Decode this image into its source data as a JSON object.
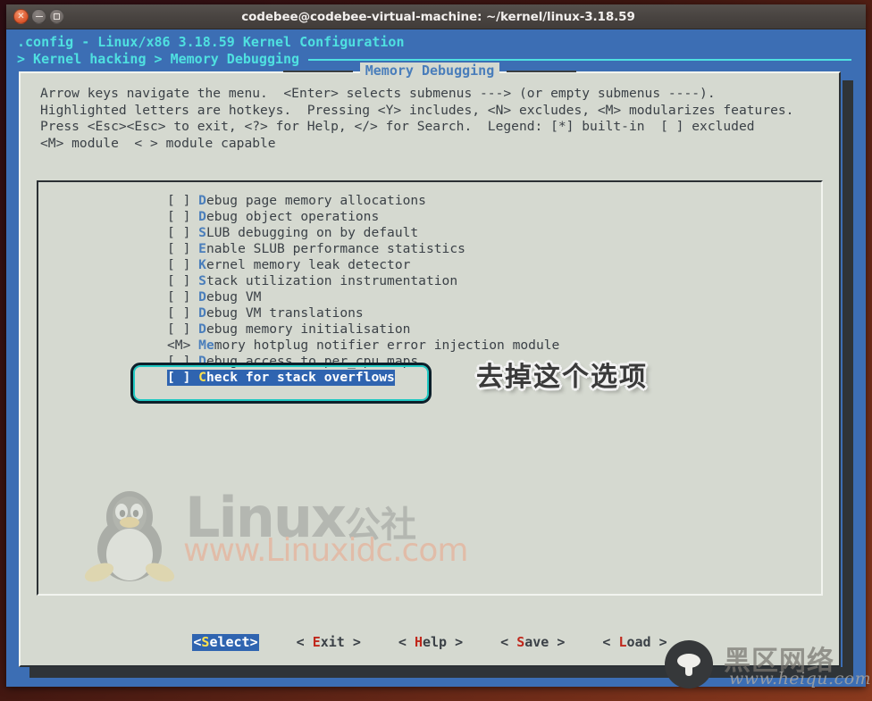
{
  "window": {
    "title": "codebee@codebee-virtual-machine: ~/kernel/linux-3.18.59",
    "controls": {
      "close": "close-icon",
      "minimize": "minimize-icon",
      "maximize": "maximize-icon"
    }
  },
  "terminal": {
    "header_line1": ".config - Linux/x86 3.18.59 Kernel Configuration",
    "header_line2": "> Kernel hacking > Memory Debugging"
  },
  "dialog": {
    "title": "Memory Debugging",
    "help_text": "Arrow keys navigate the menu.  <Enter> selects submenus ---> (or empty submenus ----).\nHighlighted letters are hotkeys.  Pressing <Y> includes, <N> excludes, <M> modularizes features.\nPress <Esc><Esc> to exit, <?> for Help, </> for Search.  Legend: [*] built-in  [ ] excluded\n<M> module  < > module capable"
  },
  "menu": {
    "items": [
      {
        "marker": "[ ]",
        "hotkey": "D",
        "rest": "ebug page memory allocations",
        "selected": false
      },
      {
        "marker": "[ ]",
        "hotkey": "D",
        "rest": "ebug object operations",
        "selected": false
      },
      {
        "marker": "[ ]",
        "hotkey": "S",
        "rest": "LUB debugging on by default",
        "selected": false
      },
      {
        "marker": "[ ]",
        "hotkey": "E",
        "rest": "nable SLUB performance statistics",
        "selected": false
      },
      {
        "marker": "[ ]",
        "hotkey": "K",
        "rest": "ernel memory leak detector",
        "selected": false
      },
      {
        "marker": "[ ]",
        "hotkey": "S",
        "rest": "tack utilization instrumentation",
        "selected": false
      },
      {
        "marker": "[ ]",
        "hotkey": "D",
        "rest": "ebug VM",
        "selected": false
      },
      {
        "marker": "[ ]",
        "hotkey": "D",
        "rest": "ebug VM translations",
        "selected": false
      },
      {
        "marker": "[ ]",
        "hotkey": "D",
        "rest": "ebug memory initialisation",
        "selected": false
      },
      {
        "marker": "<M>",
        "hotkey": "Me",
        "rest": "mory hotplug notifier error injection module",
        "selected": false
      },
      {
        "marker": "[ ]",
        "hotkey": "D",
        "rest": "ebug access to per_cpu maps",
        "selected": false
      },
      {
        "marker": "[ ]",
        "hotkey": "C",
        "rest": "heck for stack overflows",
        "selected": true
      }
    ]
  },
  "buttons": [
    {
      "pre": "<",
      "hotkey": "S",
      "post": "elect>",
      "active": true
    },
    {
      "pre": "< ",
      "hotkey": "E",
      "post": "xit >",
      "active": false
    },
    {
      "pre": "< ",
      "hotkey": "H",
      "post": "elp >",
      "active": false
    },
    {
      "pre": "< ",
      "hotkey": "S",
      "post": "ave >",
      "active": false
    },
    {
      "pre": "< ",
      "hotkey": "L",
      "post": "oad >",
      "active": false
    }
  ],
  "annotation": {
    "text": "去掉这个选项"
  },
  "watermark_linux": {
    "brand": "Linux",
    "brand_cn": "公社",
    "url": "www.Linuxidc.com"
  },
  "watermark_heiqu": {
    "name": "黑区网络",
    "url": "www.heiqu.com"
  },
  "colors": {
    "terminal_bg": "#3c6eb4",
    "dialog_bg": "#d5d9d0",
    "header_cyan": "#4fe0e0",
    "hotkey_blue": "#4a7ebb",
    "select_blue": "#2f64b0",
    "select_yellow": "#ffe14d",
    "button_red": "#c0281c",
    "anno_teal": "#1fc9c3"
  }
}
